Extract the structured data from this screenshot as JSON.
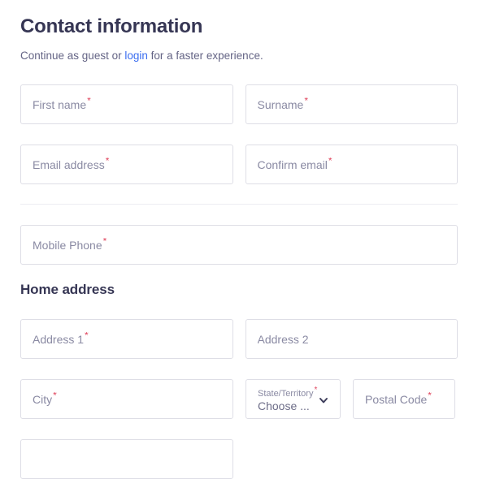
{
  "header": {
    "title": "Contact information",
    "subtitle_before": "Continue as guest or ",
    "subtitle_link": "login",
    "subtitle_after": " for a faster experience."
  },
  "required_marker": "*",
  "colors": {
    "title": "#363654",
    "body_text": "#646485",
    "link": "#3a6df0",
    "placeholder": "#8a8aa3",
    "required_asterisk": "#e0475f",
    "field_border": "#dedee6",
    "divider": "#ededf2",
    "background": "#ffffff"
  },
  "contact_section": {
    "fields": [
      {
        "name": "first-name",
        "placeholder": "First name",
        "value": "",
        "required": true
      },
      {
        "name": "surname",
        "placeholder": "Surname",
        "value": "",
        "required": true
      },
      {
        "name": "email-address",
        "placeholder": "Email address",
        "value": "",
        "required": true
      },
      {
        "name": "confirm-email",
        "placeholder": "Confirm email",
        "value": "",
        "required": true
      }
    ],
    "mobile_phone": {
      "placeholder": "Mobile Phone",
      "value": "",
      "required": true
    }
  },
  "home_address_section": {
    "title": "Home address",
    "address1": {
      "placeholder": "Address 1",
      "value": "",
      "required": true
    },
    "address2": {
      "placeholder": "Address 2",
      "value": "",
      "required": false
    },
    "city": {
      "placeholder": "City",
      "value": "",
      "required": true
    },
    "state": {
      "label": "State/Territory",
      "selected": "Choose ...",
      "required": true,
      "icon": "chevron-down-icon"
    },
    "postal_code": {
      "placeholder": "Postal Code",
      "value": "",
      "required": true
    }
  }
}
